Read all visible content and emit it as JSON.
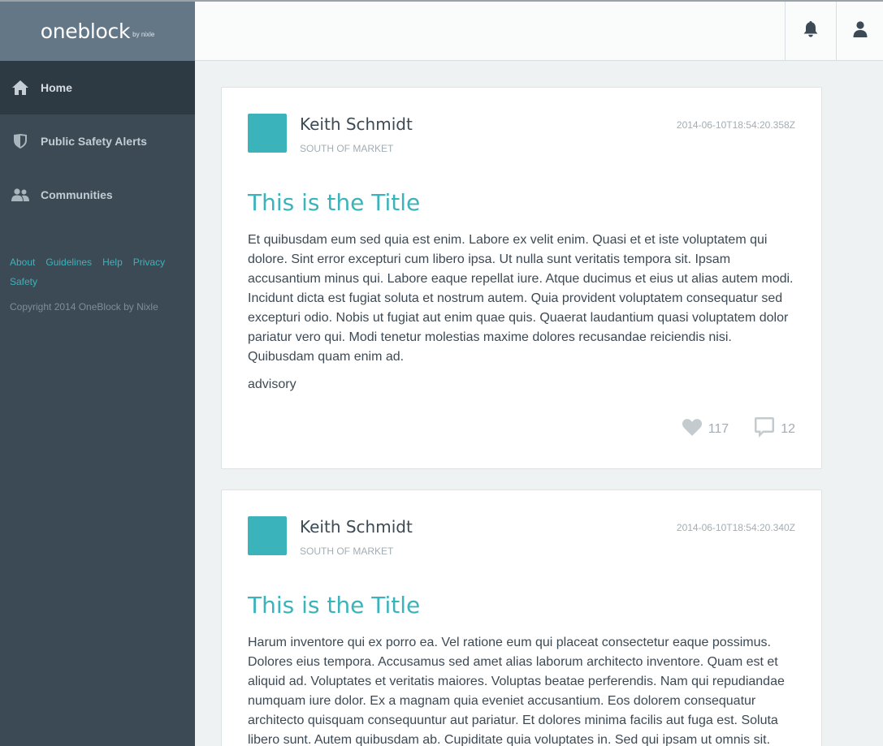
{
  "brand": {
    "name": "oneblock",
    "sub": "by nixle"
  },
  "nav": [
    {
      "label": "Home",
      "icon": "home-icon"
    },
    {
      "label": "Public Safety Alerts",
      "icon": "shield-icon"
    },
    {
      "label": "Communities",
      "icon": "users-icon"
    }
  ],
  "footer": {
    "links": [
      "About",
      "Guidelines",
      "Help",
      "Privacy",
      "Safety"
    ],
    "copyright": "Copyright 2014 OneBlock by Nixle"
  },
  "header": {
    "icons": [
      "bell-icon",
      "user-icon"
    ]
  },
  "posts": [
    {
      "author": "Keith Schmidt",
      "location": "SOUTH OF MARKET",
      "timestamp": "2014-06-10T18:54:20.358Z",
      "title": "This is the Title",
      "body": "Et quibusdam eum sed quia est enim. Labore ex velit enim. Quasi et et iste voluptatem qui dolore. Sint error excepturi cum libero ipsa. Ut nulla sunt veritatis tempora sit. Ipsam accusantium minus qui. Labore eaque repellat iure. Atque ducimus et eius ut alias autem modi. Incidunt dicta est fugiat soluta et nostrum autem. Quia provident voluptatem consequatur sed excepturi odio. Nobis ut fugiat aut enim quae quis. Quaerat laudantium quasi voluptatem dolor pariatur vero qui. Modi tenetur molestias maxime dolores recusandae reiciendis nisi. Quibusdam quam enim ad.",
      "tag": "advisory",
      "likes": "117",
      "comments": "12"
    },
    {
      "author": "Keith Schmidt",
      "location": "SOUTH OF MARKET",
      "timestamp": "2014-06-10T18:54:20.340Z",
      "title": "This is the Title",
      "body": "Harum inventore qui ex porro ea. Vel ratione eum qui placeat consectetur eaque possimus. Dolores eius tempora. Accusamus sed amet alias laborum architecto inventore. Quam est et aliquid ad. Voluptates et veritatis maiores. Voluptas beatae perferendis. Nam qui repudiandae numquam iure dolor. Ex a magnam quia eveniet accusantium. Eos dolorem consequatur architecto quisquam consequuntur aut pariatur. Et dolores minima facilis aut fuga est. Soluta libero sunt. Autem quibusdam ab. Cupiditate quia voluptates in. Sed qui ipsam ut omnis sit."
    }
  ],
  "colors": {
    "accent": "#3bb3bb",
    "sidebar": "#3c4a55",
    "brand_bar": "#647787",
    "active_nav": "#2e3a43"
  }
}
